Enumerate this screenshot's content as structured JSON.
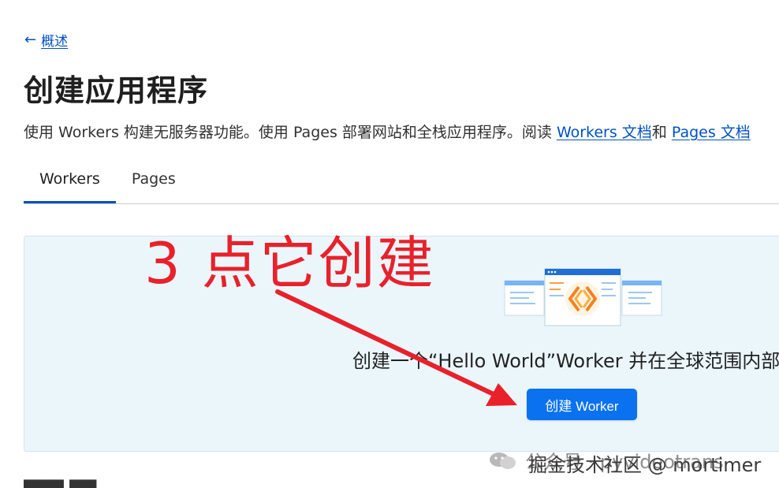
{
  "back_link": {
    "arrow": "←",
    "label": "概述"
  },
  "page_title": "创建应用程序",
  "description": {
    "text": "使用 Workers 构建无服务器功能。使用 Pages 部署网站和全栈应用程序。阅读 ",
    "link_workers_docs": "Workers 文档",
    "connector": "和 ",
    "link_pages_docs": "Pages 文档"
  },
  "tabs": [
    {
      "label": "Workers",
      "active": true
    },
    {
      "label": "Pages",
      "active": false
    }
  ],
  "panel": {
    "text": "创建一个“Hello World”Worker 并在全球范围内部",
    "button_label": "创建 Worker"
  },
  "annotation": {
    "text": "3 点它创建",
    "color": "#e8212b"
  },
  "watermark": {
    "line1": "公众号 · pyvideotrans",
    "line2": "掘金技术社区 @ mortimer"
  },
  "colors": {
    "accent": "#0051c3",
    "button": "#0a72ef",
    "panel_bg": "#ebf6fb",
    "annotation": "#e8212b"
  }
}
